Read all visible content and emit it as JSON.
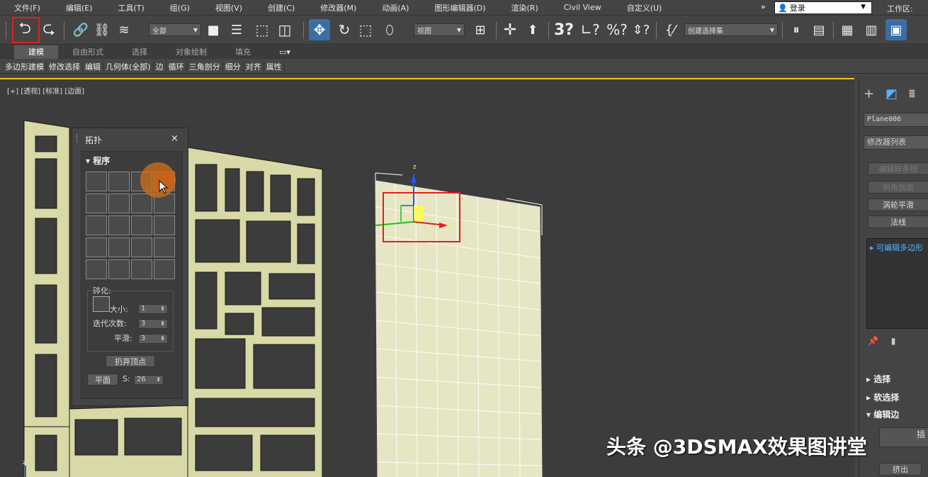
{
  "menu": [
    "文件(F)",
    "编辑(E)",
    "工具(T)",
    "组(G)",
    "视图(V)",
    "创建(C)",
    "修改器(M)",
    "动画(A)",
    "图形编辑器(D)",
    "渲染(R)",
    "Civil View",
    "自定义(U)"
  ],
  "menu_overflow": "»",
  "login": "登录",
  "workspace_label": "工作区:",
  "toolbar": {
    "selection_filter": "全部",
    "ref_coord": "视图",
    "named_selection": "创建选择集",
    "snap_angle_label": "3",
    "undo_icon": "undo-icon",
    "redo_icon": "redo-icon"
  },
  "ribbon_tabs": [
    "建模",
    "自由形式",
    "选择",
    "对象绘制",
    "填充"
  ],
  "ribbon_sub": [
    "多边形建模",
    "修改选择",
    "编辑",
    "几何体(全部)",
    "边",
    "循环",
    "三角剖分",
    "细分",
    "对齐",
    "属性"
  ],
  "viewport": {
    "label": "[+] [透视] [标准] [边面]"
  },
  "topology_panel": {
    "title": "拓扑",
    "close": "×",
    "section": "程序",
    "fragment_label": "碎化:",
    "size_label": "大小:",
    "size_value": "1",
    "iter_label": "迭代次数:",
    "iter_value": "3",
    "smooth_label": "平滑:",
    "smooth_value": "3",
    "discard_button": "扔弃顶点",
    "plane_button": "平面",
    "s_label": "S:",
    "s_value": "26"
  },
  "command_panel": {
    "object_name": "Plane006",
    "modifier_list": "修改器列表",
    "buttons": [
      "编辑样条线",
      "倒角剖面",
      "涡轮平滑",
      "法线"
    ],
    "stack_item": "可编辑多边形",
    "rollouts": [
      "选择",
      "软选择",
      "编辑边"
    ],
    "insert_label": "插",
    "extrude_button": "挤出"
  },
  "watermark": "头条 @3DSMAX效果图讲堂"
}
